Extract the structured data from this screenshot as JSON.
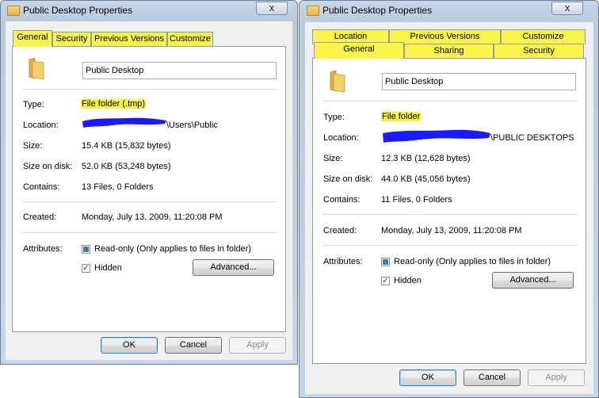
{
  "left": {
    "title": "Public Desktop Properties",
    "close": "x",
    "tabs": [
      "General",
      "Security",
      "Previous Versions",
      "Customize"
    ],
    "name_value": "Public Desktop",
    "type_label": "Type:",
    "type_value": "File folder (.tmp)",
    "location_label": "Location:",
    "location_value": "\\Users\\Public",
    "size_label": "Size:",
    "size_value": "15.4 KB (15,832 bytes)",
    "sizeondisk_label": "Size on disk:",
    "sizeondisk_value": "52.0 KB (53,248 bytes)",
    "contains_label": "Contains:",
    "contains_value": "13 Files, 0 Folders",
    "created_label": "Created:",
    "created_value": "Monday, July 13, 2009, 11:20:08 PM",
    "attributes_label": "Attributes:",
    "readonly_label": "Read-only (Only applies to files in folder)",
    "hidden_label": "Hidden",
    "advanced_label": "Advanced...",
    "ok_label": "OK",
    "cancel_label": "Cancel",
    "apply_label": "Apply"
  },
  "right": {
    "title": "Public Desktop Properties",
    "close": "x",
    "tabs_top": [
      "Location",
      "Previous Versions",
      "Customize"
    ],
    "tabs_bottom": [
      "General",
      "Sharing",
      "Security"
    ],
    "name_value": "Public Desktop",
    "type_label": "Type:",
    "type_value": "File folder",
    "location_label": "Location:",
    "location_value": "\\PUBLIC DESKTOPS",
    "size_label": "Size:",
    "size_value": "12.3 KB (12,628 bytes)",
    "sizeondisk_label": "Size on disk:",
    "sizeondisk_value": "44.0 KB (45,056 bytes)",
    "contains_label": "Contains:",
    "contains_value": "11 Files, 0 Folders",
    "created_label": "Created:",
    "created_value": "Monday, July 13, 2009, 11:20:08 PM",
    "attributes_label": "Attributes:",
    "readonly_label": "Read-only (Only applies to files in folder)",
    "hidden_label": "Hidden",
    "advanced_label": "Advanced...",
    "ok_label": "OK",
    "cancel_label": "Cancel",
    "apply_label": "Apply"
  },
  "colors": {
    "highlight": "#f9f33c",
    "redaction": "#1a1aff",
    "selection_accent": "#3c7fb1"
  }
}
